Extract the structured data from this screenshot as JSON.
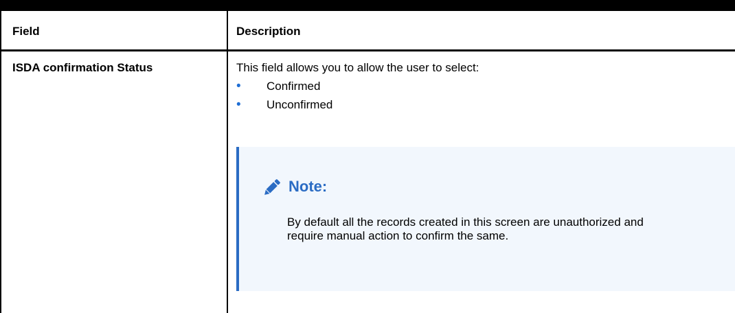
{
  "table": {
    "headers": {
      "field": "Field",
      "description": "Description"
    },
    "rows": [
      {
        "field": "ISDA confirmation Status",
        "description_intro": "This field allows you to allow the user to select:",
        "options": [
          "Confirmed",
          "Unconfirmed"
        ],
        "note": {
          "title": "Note:",
          "icon": "pencil-icon",
          "text": "By default all the records created in this screen are unauthorized and require manual action to confirm the same."
        }
      }
    ]
  },
  "colors": {
    "accent": "#2b6cc4",
    "bullet": "#1f6ed4",
    "note_background": "#f2f7fd"
  }
}
